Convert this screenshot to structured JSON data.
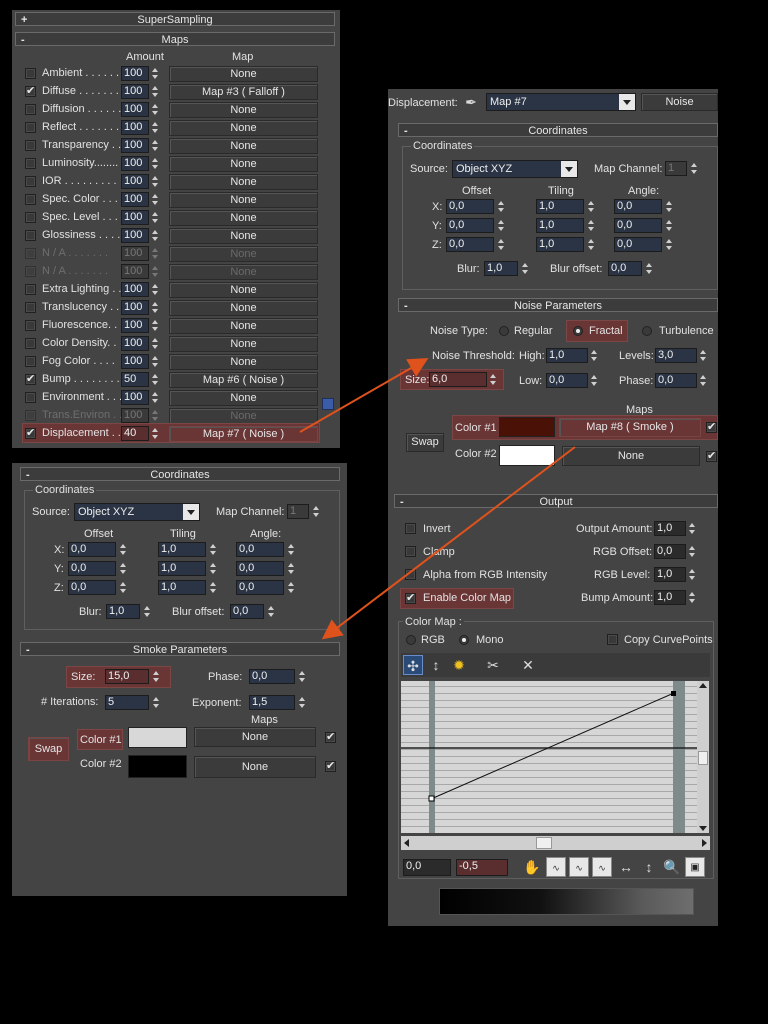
{
  "maps_panel": {
    "supersampling_title": "SuperSampling",
    "maps_title": "Maps",
    "col_amount": "Amount",
    "col_map": "Map",
    "rows": [
      {
        "label": "Ambient . . . . . .",
        "amount": "100",
        "map": "None",
        "checked": false,
        "dim": false
      },
      {
        "label": "Diffuse . . . . . . .",
        "amount": "100",
        "map": "Map #3  ( Falloff )",
        "checked": true,
        "dim": false
      },
      {
        "label": "Diffusion . . . . . .",
        "amount": "100",
        "map": "None",
        "checked": false,
        "dim": false
      },
      {
        "label": "Reflect . . . . . . .",
        "amount": "100",
        "map": "None",
        "checked": false,
        "dim": false
      },
      {
        "label": "Transparency . .",
        "amount": "100",
        "map": "None",
        "checked": false,
        "dim": false
      },
      {
        "label": "Luminosity........",
        "amount": "100",
        "map": "None",
        "checked": false,
        "dim": false
      },
      {
        "label": "IOR . . . . . . . . .",
        "amount": "100",
        "map": "None",
        "checked": false,
        "dim": false
      },
      {
        "label": "Spec. Color . . .",
        "amount": "100",
        "map": "None",
        "checked": false,
        "dim": false
      },
      {
        "label": "Spec. Level . . .",
        "amount": "100",
        "map": "None",
        "checked": false,
        "dim": false
      },
      {
        "label": "Glossiness . . . .",
        "amount": "100",
        "map": "None",
        "checked": false,
        "dim": false
      },
      {
        "label": "N / A . . . . . . .",
        "amount": "100",
        "map": "None",
        "checked": false,
        "dim": true
      },
      {
        "label": "N / A . . . . . . .",
        "amount": "100",
        "map": "None",
        "checked": false,
        "dim": true
      },
      {
        "label": "Extra Lighting . .",
        "amount": "100",
        "map": "None",
        "checked": false,
        "dim": false
      },
      {
        "label": "Translucency . .",
        "amount": "100",
        "map": "None",
        "checked": false,
        "dim": false
      },
      {
        "label": "Fluorescence. .",
        "amount": "100",
        "map": "None",
        "checked": false,
        "dim": false
      },
      {
        "label": "Color Density. .",
        "amount": "100",
        "map": "None",
        "checked": false,
        "dim": false
      },
      {
        "label": "Fog Color . . . .",
        "amount": "100",
        "map": "None",
        "checked": false,
        "dim": false
      },
      {
        "label": "Bump . . . . . . . .",
        "amount": "50",
        "map": "Map #6  ( Noise )",
        "checked": true,
        "dim": false
      },
      {
        "label": "Environment . . .",
        "amount": "100",
        "map": "None",
        "checked": false,
        "dim": false
      },
      {
        "label": "Trans.Environ . .",
        "amount": "100",
        "map": "None",
        "checked": false,
        "dim": true
      },
      {
        "label": "Displacement . .",
        "amount": "40",
        "map": "Map #7  ( Noise )",
        "checked": true,
        "dim": false,
        "highlight": true
      }
    ]
  },
  "noise_panel": {
    "displacement_label": "Displacement:",
    "map_select": "Map #7",
    "type_button": "Noise",
    "coordinates": {
      "title": "Coordinates",
      "group": "Coordinates",
      "source_label": "Source:",
      "source_value": "Object XYZ",
      "map_channel_label": "Map Channel:",
      "map_channel_value": "1",
      "offset": "Offset",
      "tiling": "Tiling",
      "angle": "Angle:",
      "x": "X:",
      "y": "Y:",
      "z": "Z:",
      "vals": {
        "ox": "0,0",
        "oy": "0,0",
        "oz": "0,0",
        "tx": "1,0",
        "ty": "1,0",
        "tz": "1,0",
        "ax": "0,0",
        "ay": "0,0",
        "az": "0,0"
      },
      "blur_label": "Blur:",
      "blur": "1,0",
      "blur_offset_label": "Blur offset:",
      "blur_offset": "0,0"
    },
    "noise_params": {
      "title": "Noise Parameters",
      "noise_type_label": "Noise Type:",
      "regular": "Regular",
      "fractal": "Fractal",
      "turbulence": "Turbulence",
      "threshold_label": "Noise Threshold:",
      "high_label": "High:",
      "high": "1,0",
      "low_label": "Low:",
      "low": "0,0",
      "levels_label": "Levels:",
      "levels": "3,0",
      "phase_label": "Phase:",
      "phase": "0,0",
      "size_label": "Size:",
      "size": "6,0",
      "maps_label": "Maps",
      "color1_label": "Color #1",
      "color1_map": "Map #8  ( Smoke )",
      "color2_label": "Color #2",
      "color2_map": "None",
      "swap": "Swap",
      "color1": "#4a1206",
      "color2": "#ffffff"
    },
    "output": {
      "title": "Output",
      "invert": "Invert",
      "clamp": "Clamp",
      "alpha": "Alpha from RGB Intensity",
      "enable_color_map": "Enable Color Map",
      "output_amount_label": "Output Amount:",
      "output_amount": "1,0",
      "rgb_offset_label": "RGB Offset:",
      "rgb_offset": "0,0",
      "rgb_level_label": "RGB Level:",
      "rgb_level": "1,0",
      "bump_amount_label": "Bump Amount:",
      "bump_amount": "1,0",
      "color_map_label": "Color Map :",
      "rgb": "RGB",
      "mono": "Mono",
      "copy_curve": "Copy CurvePoints",
      "axis_zero": "0",
      "coord_x": "0,0",
      "coord_y": "-0,5"
    }
  },
  "smoke_panel": {
    "coordinates": {
      "title": "Coordinates",
      "group": "Coordinates",
      "source_label": "Source:",
      "source_value": "Object XYZ",
      "map_channel_label": "Map Channel:",
      "map_channel_value": "1",
      "offset": "Offset",
      "tiling": "Tiling",
      "angle": "Angle:",
      "x": "X:",
      "y": "Y:",
      "z": "Z:",
      "vals": {
        "ox": "0,0",
        "oy": "0,0",
        "oz": "0,0",
        "tx": "1,0",
        "ty": "1,0",
        "tz": "1,0",
        "ax": "0,0",
        "ay": "0,0",
        "az": "0,0"
      },
      "blur_label": "Blur:",
      "blur": "1,0",
      "blur_offset_label": "Blur offset:",
      "blur_offset": "0,0"
    },
    "smoke_params": {
      "title": "Smoke Parameters",
      "size_label": "Size:",
      "size": "15,0",
      "phase_label": "Phase:",
      "phase": "0,0",
      "iterations_label": "# Iterations:",
      "iterations": "5",
      "exponent_label": "Exponent:",
      "exponent": "1,5",
      "maps_label": "Maps",
      "swap": "Swap",
      "color1_label": "Color #1",
      "color1_map": "None",
      "color2_label": "Color #2",
      "color2_map": "None",
      "color1": "#d8d8d8",
      "color2": "#000000"
    }
  },
  "colors": {
    "panel": "#444444",
    "highlight": "#6a3535",
    "arrow": "#e0521c"
  }
}
